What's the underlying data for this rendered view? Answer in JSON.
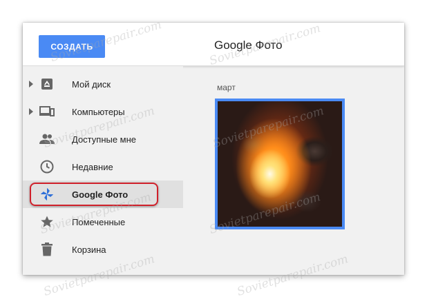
{
  "header": {
    "create_label": "СОЗДАТЬ",
    "title": "Google Фото"
  },
  "sidebar": {
    "items": [
      {
        "label": "Мой диск",
        "icon": "drive-icon",
        "expandable": true
      },
      {
        "label": "Компьютеры",
        "icon": "computers-icon",
        "expandable": true
      },
      {
        "label": "Доступные мне",
        "icon": "shared-people-icon",
        "expandable": false
      },
      {
        "label": "Недавние",
        "icon": "clock-icon",
        "expandable": false
      },
      {
        "label": "Google Фото",
        "icon": "google-photos-pinwheel-icon",
        "expandable": false,
        "active": true
      },
      {
        "label": "Помеченные",
        "icon": "star-icon",
        "expandable": false
      },
      {
        "label": "Корзина",
        "icon": "trash-icon",
        "expandable": false
      }
    ]
  },
  "content": {
    "section_label": "март"
  },
  "watermark": {
    "text": "Sovietparepair.com"
  },
  "colors": {
    "accent": "#4a8af4",
    "highlight_ring": "#d0202a",
    "active_row": "#e0e0e0"
  }
}
